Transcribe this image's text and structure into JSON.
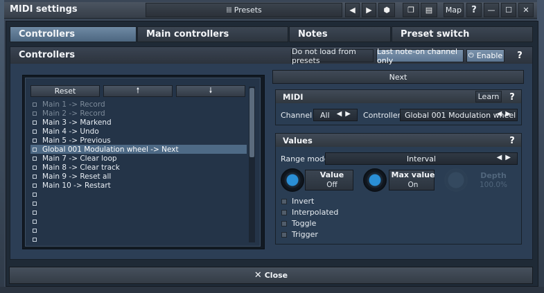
{
  "app": {
    "title": "MIDI settings"
  },
  "titlebar": {
    "presets_label": "Presets",
    "map_label": "Map",
    "help_label": "?",
    "minimize_glyph": "—",
    "maximize_glyph": "☐",
    "close_glyph": "✕",
    "prev_glyph": "◀",
    "next_glyph": "▶"
  },
  "tabs": [
    {
      "label": "Controllers",
      "active": true
    },
    {
      "label": "Main controllers"
    },
    {
      "label": "Notes"
    },
    {
      "label": "Preset switch"
    }
  ],
  "panel": {
    "title": "Controllers",
    "not_load_label": "Do not load from presets",
    "last_note_label": "Last note-on channel only",
    "enable_label": "Enable",
    "help_label": "?"
  },
  "list": {
    "reset_label": "Reset",
    "up_glyph": "🠕",
    "down_glyph": "🠗",
    "items": [
      "Main 1 -> Record",
      "Main 2 -> Record",
      "Main 3 -> Markend",
      "Main 4 -> Undo",
      "Main 5 -> Previous",
      "Global 001 Modulation wheel -> Next",
      "Main 7 -> Clear loop",
      "Main 8 -> Clear track",
      "Main 9 -> Reset all",
      "Main 10 -> Restart",
      "",
      "",
      "",
      "",
      "",
      "",
      ""
    ]
  },
  "detail": {
    "name": "Next",
    "midi": {
      "title": "MIDI",
      "learn_label": "Learn",
      "help_label": "?",
      "channel_label": "Channel",
      "channel_value": "All",
      "controller_label": "Controller",
      "controller_value": "Global 001 Modulation wheel"
    },
    "values": {
      "title": "Values",
      "help_label": "?",
      "range_mode_label": "Range mode",
      "range_mode_value": "Interval",
      "value_label": "Value",
      "value_state": "Off",
      "max_value_label": "Max value",
      "max_value_state": "On",
      "depth_label": "Depth",
      "depth_value": "100.0%",
      "options": [
        "Invert",
        "Interpolated",
        "Toggle",
        "Trigger"
      ]
    }
  },
  "footer": {
    "close_label": "Close"
  },
  "colors": {
    "accent": "#2a8fd6",
    "selection": "#4e6a86",
    "panel": "#2c3e55"
  }
}
